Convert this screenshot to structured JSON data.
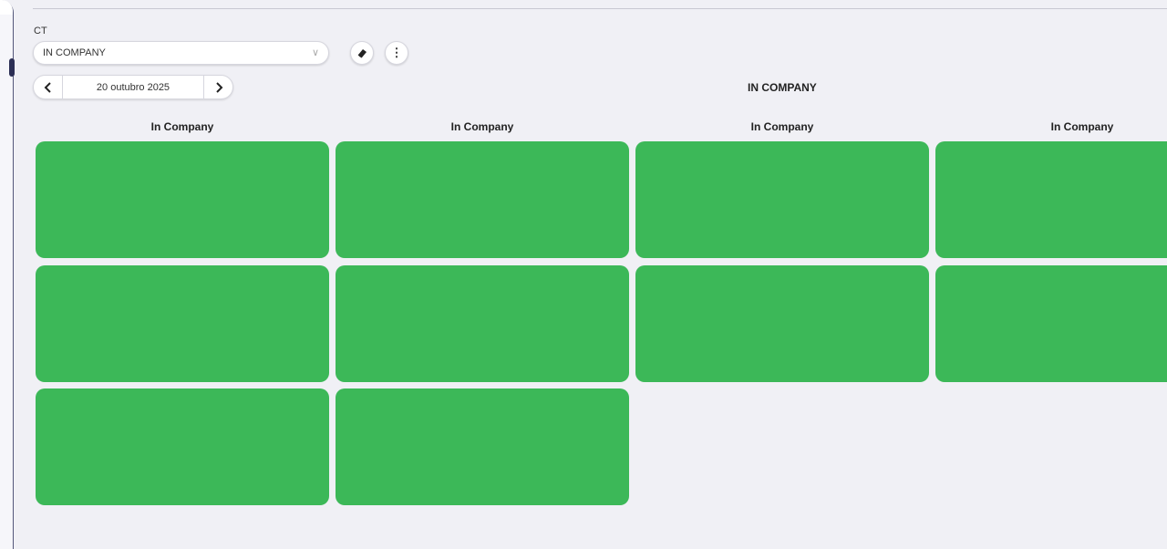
{
  "filter": {
    "label": "CT",
    "selected": "IN COMPANY",
    "chevron": "∨"
  },
  "toolbar": {
    "eraser_icon": "eraser-icon",
    "more_icon": "more-vertical-icon",
    "more_glyph": "⋮"
  },
  "date_nav": {
    "prev": "‹",
    "date": "20 outubro 2025",
    "next": "›"
  },
  "page_title": "IN COMPANY",
  "columns": [
    {
      "header": "In Company"
    },
    {
      "header": "In Company"
    },
    {
      "header": "In Company"
    },
    {
      "header": "In Company"
    }
  ],
  "colors": {
    "card": "#3cb858",
    "background": "#f0f0f5"
  }
}
